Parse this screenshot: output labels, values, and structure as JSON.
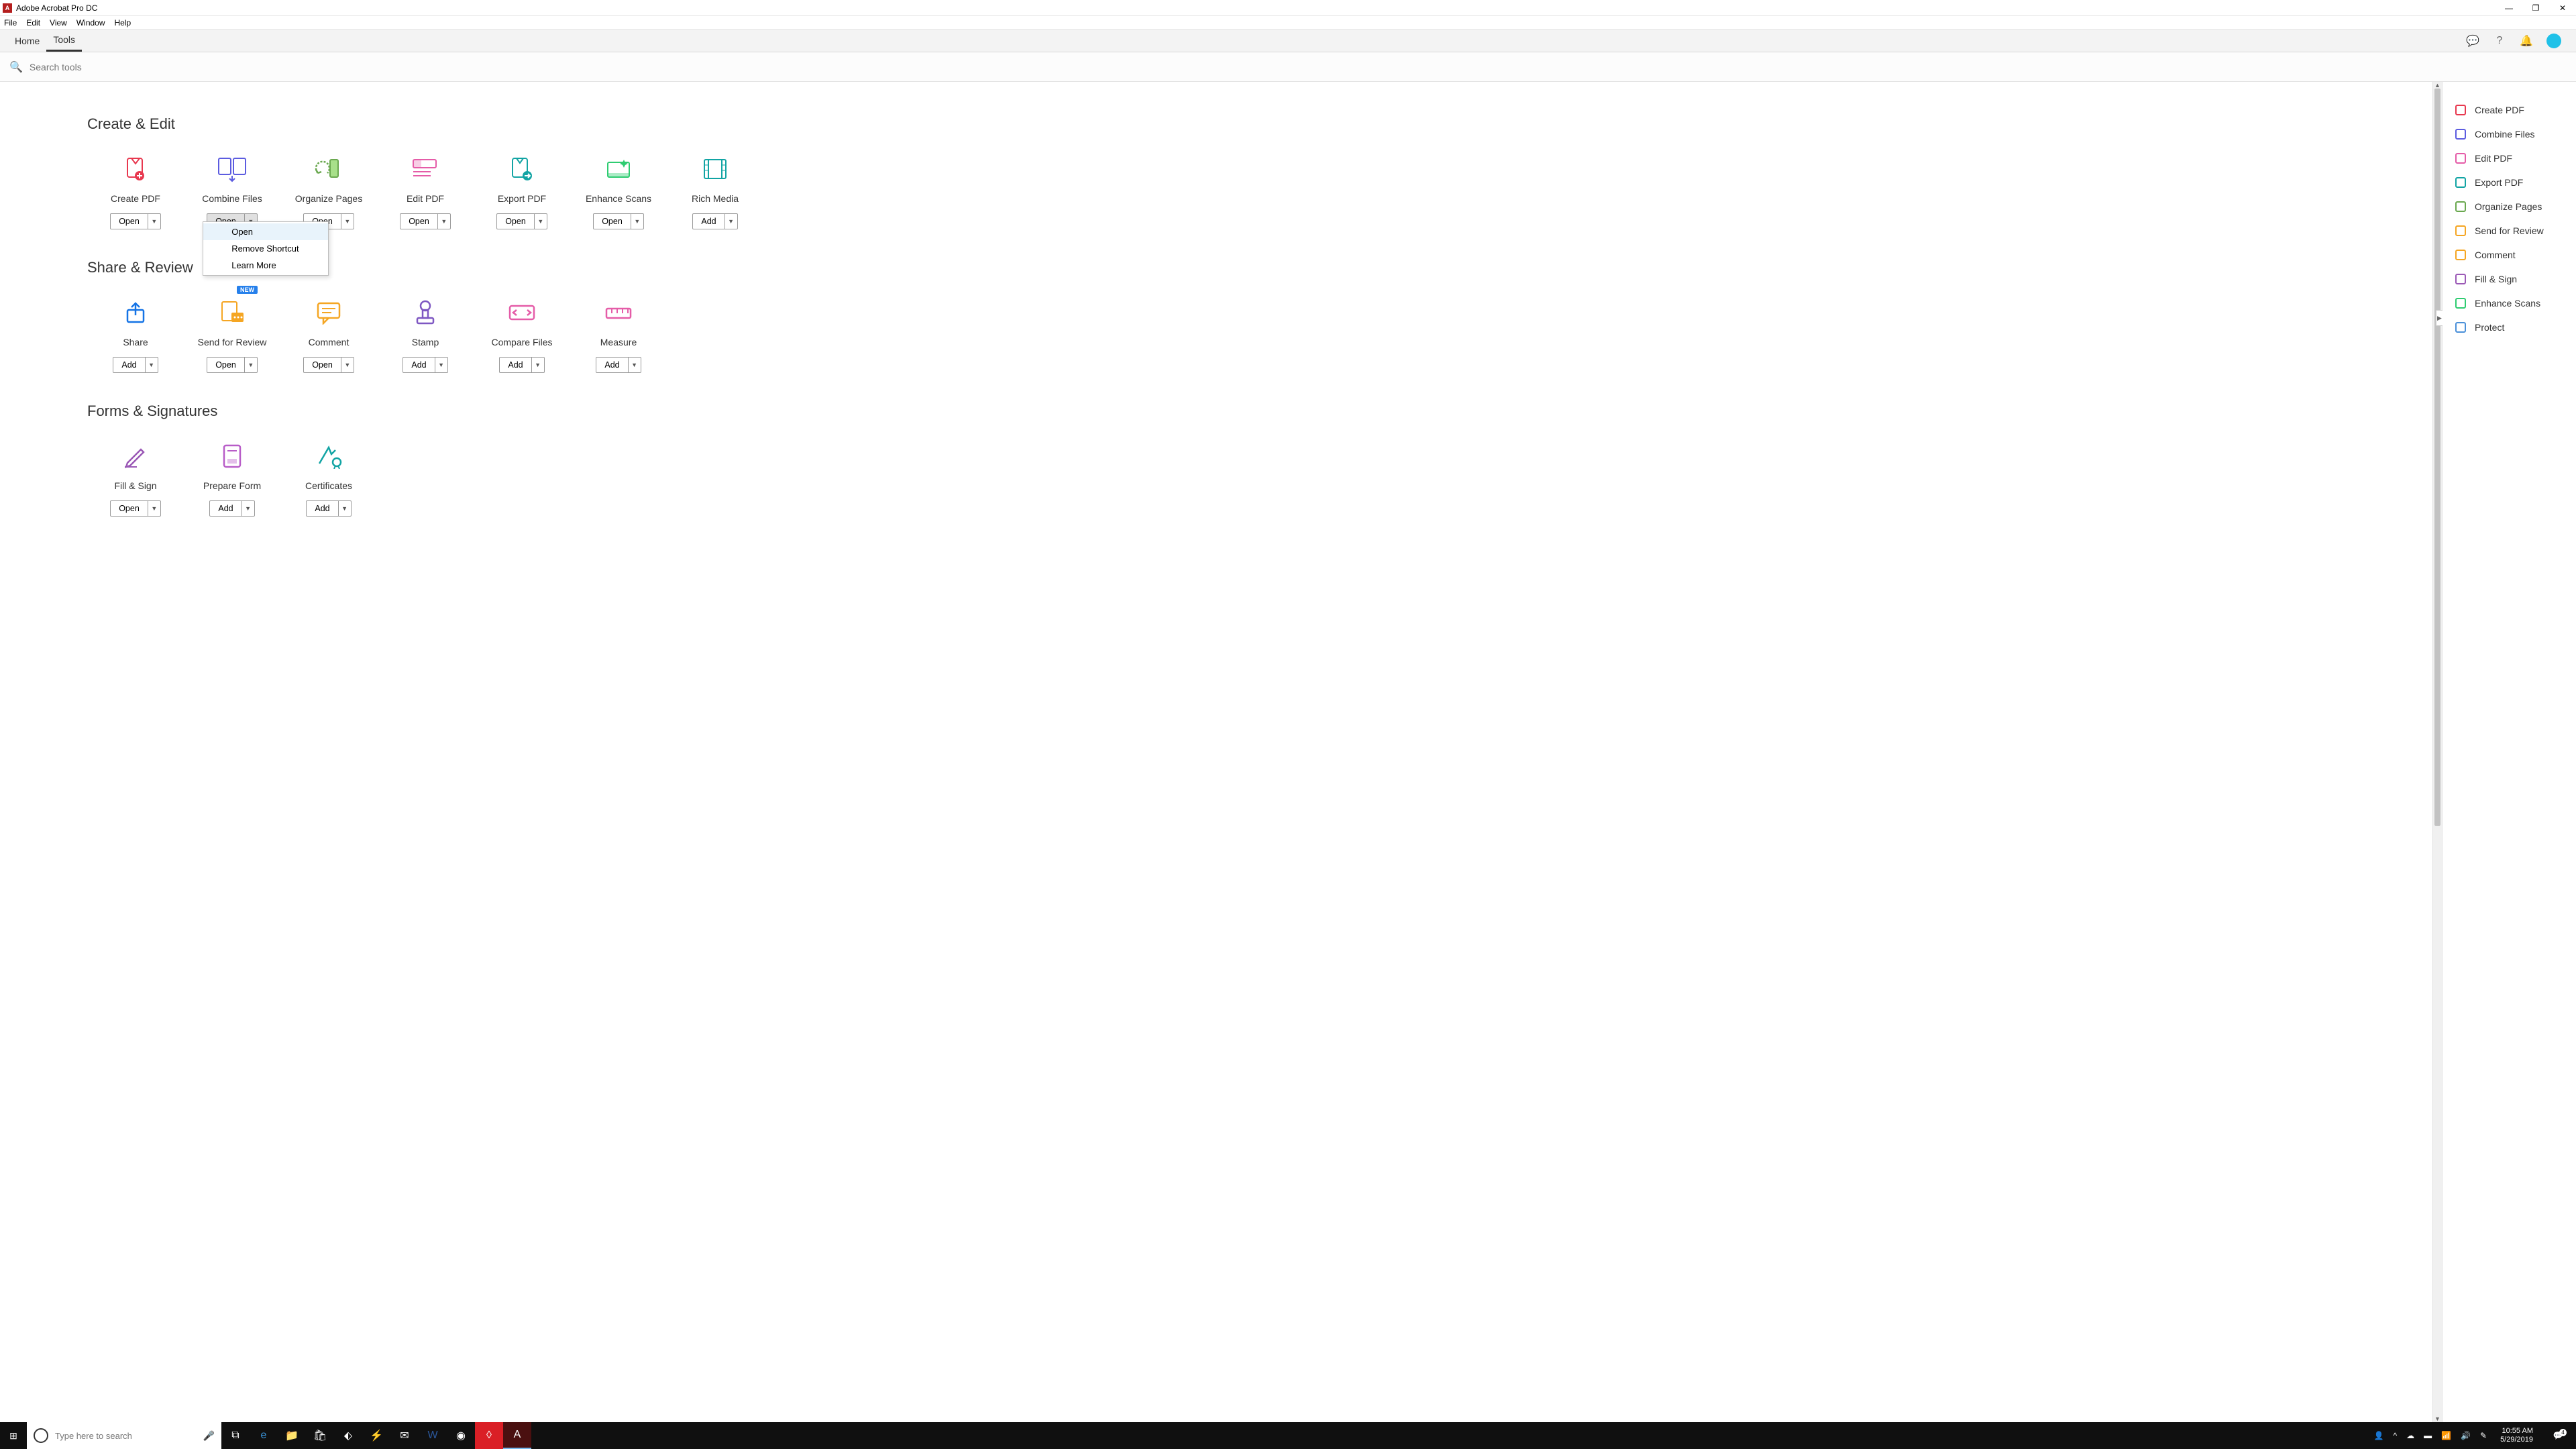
{
  "title": "Adobe Acrobat Pro DC",
  "menus": [
    "File",
    "Edit",
    "View",
    "Window",
    "Help"
  ],
  "tabs": {
    "home": "Home",
    "tools": "Tools"
  },
  "search": {
    "placeholder": "Search tools"
  },
  "buttons": {
    "open": "Open",
    "add": "Add"
  },
  "badge_new": "NEW",
  "sections": [
    {
      "title": "Create & Edit",
      "tools": [
        {
          "id": "create-pdf",
          "label": "Create PDF",
          "btn": "open"
        },
        {
          "id": "combine-files",
          "label": "Combine Files",
          "btn": "open",
          "active": true,
          "dropdown": true
        },
        {
          "id": "organize-pages",
          "label": "Organize Pages",
          "btn": "open"
        },
        {
          "id": "edit-pdf",
          "label": "Edit PDF",
          "btn": "open"
        },
        {
          "id": "export-pdf",
          "label": "Export PDF",
          "btn": "open"
        },
        {
          "id": "enhance-scans",
          "label": "Enhance Scans",
          "btn": "open"
        },
        {
          "id": "rich-media",
          "label": "Rich Media",
          "btn": "add"
        }
      ]
    },
    {
      "title": "Share & Review",
      "tools": [
        {
          "id": "share",
          "label": "Share",
          "btn": "add"
        },
        {
          "id": "send-for-review",
          "label": "Send for Review",
          "btn": "open",
          "new": true
        },
        {
          "id": "comment",
          "label": "Comment",
          "btn": "open"
        },
        {
          "id": "stamp",
          "label": "Stamp",
          "btn": "add"
        },
        {
          "id": "compare-files",
          "label": "Compare Files",
          "btn": "add"
        },
        {
          "id": "measure",
          "label": "Measure",
          "btn": "add"
        }
      ]
    },
    {
      "title": "Forms & Signatures",
      "tools": [
        {
          "id": "fill-sign",
          "label": "Fill & Sign",
          "btn": "open"
        },
        {
          "id": "prepare-form",
          "label": "Prepare Form",
          "btn": "add"
        },
        {
          "id": "certificates",
          "label": "Certificates",
          "btn": "add"
        }
      ]
    }
  ],
  "dropdown_menu": [
    {
      "label": "Open",
      "hover": true
    },
    {
      "label": "Remove Shortcut"
    },
    {
      "label": "Learn More"
    }
  ],
  "sidebar": [
    {
      "id": "create-pdf",
      "label": "Create PDF"
    },
    {
      "id": "combine-files",
      "label": "Combine Files"
    },
    {
      "id": "edit-pdf",
      "label": "Edit PDF"
    },
    {
      "id": "export-pdf",
      "label": "Export PDF"
    },
    {
      "id": "organize-pages",
      "label": "Organize Pages"
    },
    {
      "id": "send-for-review",
      "label": "Send for Review"
    },
    {
      "id": "comment",
      "label": "Comment"
    },
    {
      "id": "fill-sign",
      "label": "Fill & Sign"
    },
    {
      "id": "enhance-scans",
      "label": "Enhance Scans"
    },
    {
      "id": "protect",
      "label": "Protect"
    }
  ],
  "icon_colors": {
    "create-pdf": "#e8384f",
    "combine-files": "#5c5ce0",
    "organize-pages": "#6aa84f",
    "edit-pdf": "#e55ca8",
    "export-pdf": "#12a4a4",
    "enhance-scans": "#2ecc71",
    "rich-media": "#12a4a4",
    "share": "#1473e6",
    "send-for-review": "#f5a623",
    "comment": "#f5a623",
    "stamp": "#7e57c2",
    "compare-files": "#e55ca8",
    "measure": "#e55ca8",
    "fill-sign": "#9b59b6",
    "prepare-form": "#b85cc8",
    "certificates": "#12a4a4",
    "protect": "#4a90d9"
  },
  "taskbar": {
    "search_placeholder": "Type here to search",
    "time": "10:55 AM",
    "date": "5/29/2019",
    "notif_count": "4"
  }
}
